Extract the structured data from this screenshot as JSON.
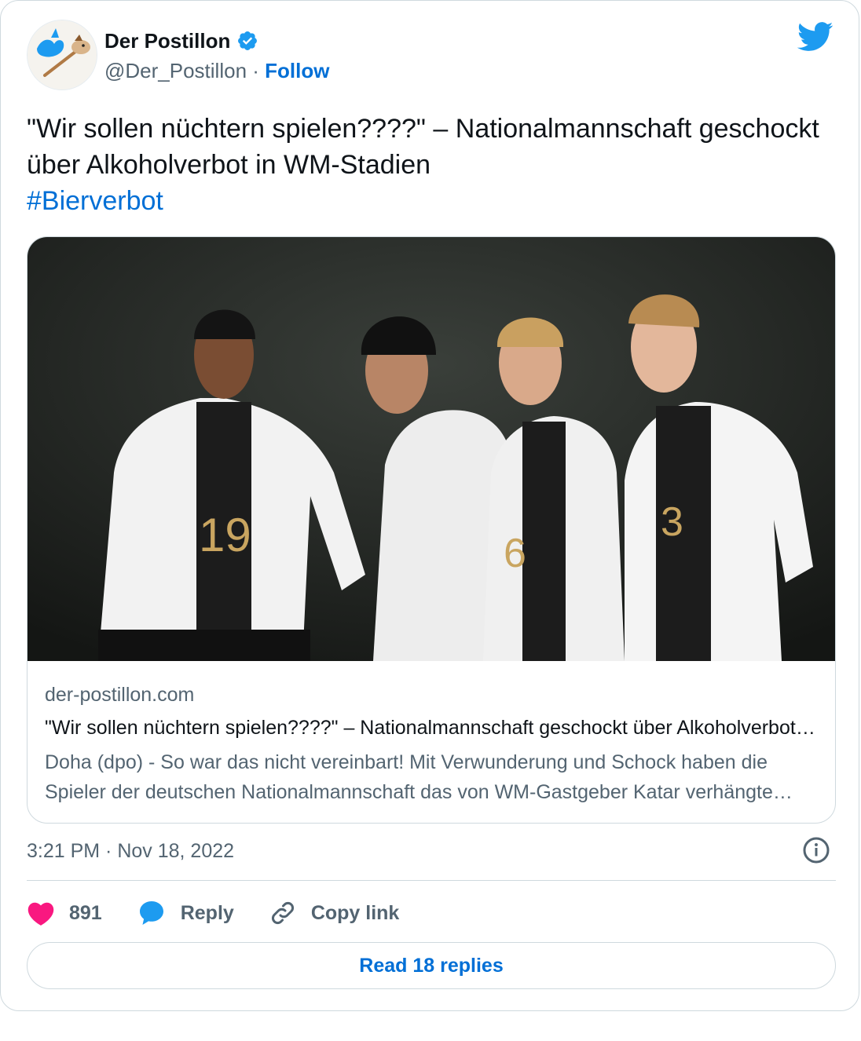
{
  "author": {
    "name": "Der Postillon",
    "handle": "@Der_Postillon",
    "separator": "·",
    "follow_label": "Follow"
  },
  "tweet": {
    "text": "\"Wir sollen nüchtern spielen????\" – Nationalmannschaft geschockt über Alkoholverbot in WM-Stadien",
    "hashtag": "#Bierverbot"
  },
  "link_card": {
    "domain": "der-postillon.com",
    "title": "\"Wir sollen nüchtern spielen????\" – Nationalmannschaft geschockt über Alkoholverbot in WM-Stadien",
    "description": "Doha (dpo) - So war das nicht vereinbart! Mit Verwunderung und Schock haben die Spieler der deutschen Nationalmannschaft das von WM-Gastgeber Katar verhängte Alkoholverbot aufgenommen.",
    "jersey_numbers": [
      "19",
      "6",
      "3"
    ]
  },
  "timestamp": "3:21 PM · Nov 18, 2022",
  "actions": {
    "like_count": "891",
    "reply_label": "Reply",
    "copy_label": "Copy link"
  },
  "read_replies_label": "Read 18 replies",
  "colors": {
    "accent": "#006fd6",
    "twitter_blue": "#1d9bf0",
    "like": "#f91880",
    "muted": "#536471",
    "border": "#cfd9de"
  },
  "icons": [
    "twitter-bird-icon",
    "verified-badge-icon",
    "info-icon",
    "heart-icon",
    "reply-bubble-icon",
    "link-icon"
  ]
}
